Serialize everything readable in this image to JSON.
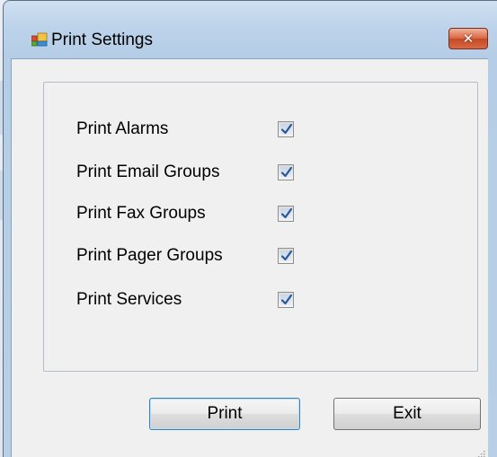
{
  "window": {
    "title": "Print Settings",
    "icon": "settings-window-icon",
    "close_icon": "close-icon"
  },
  "options": [
    {
      "label": "Print Alarms",
      "checked": true
    },
    {
      "label": "Print Email Groups",
      "checked": true
    },
    {
      "label": "Print Fax Groups",
      "checked": true
    },
    {
      "label": "Print Pager Groups",
      "checked": true
    },
    {
      "label": "Print Services",
      "checked": true
    }
  ],
  "buttons": {
    "print_label": "Print",
    "exit_label": "Exit"
  },
  "colors": {
    "close_button": "#d9643f",
    "checkmark": "#2b5797",
    "default_button_border": "#3c7fb1"
  }
}
